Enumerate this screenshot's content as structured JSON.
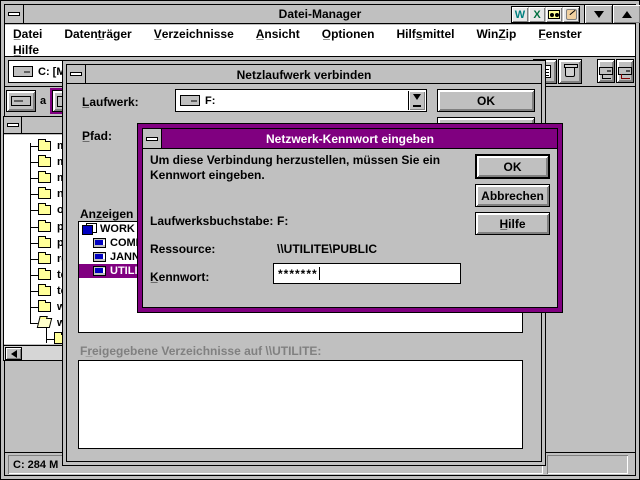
{
  "window": {
    "title": "Datei-Manager",
    "menu_row1": [
      "D̲atei",
      "Datent̲räger",
      "V̲erzeichnisse",
      "A̲nsicht",
      "O̲ptionen",
      "Hilfs̲mittel",
      "WinZ̲ip",
      "F̲enster"
    ],
    "menu_row2": [
      "H̲ilfe"
    ],
    "quick_icons": {
      "word": "W",
      "excel": "X"
    }
  },
  "filemanager": {
    "drive_combo_value": "C: [M",
    "drivebar_letter": "a",
    "tree_items": [
      "mirc",
      "msi",
      "mso",
      "net",
      "ope",
      "pma",
      "psp",
      "rea",
      "tera",
      "tota",
      "wel",
      "win",
      ""
    ],
    "status_left": "C: 284 M",
    "status_right": ""
  },
  "connect_dialog": {
    "title": "Netzlaufwerk verbinden",
    "drive_label": "L̲aufwerk:",
    "drive_value": "F:",
    "path_label": "P̲fad:",
    "ok_label": "OK",
    "browse_label": "Anz̲eigen",
    "computers": [
      {
        "name": "WORK",
        "type": "workgroup",
        "selected": false
      },
      {
        "name": "COMP",
        "type": "computer",
        "selected": false
      },
      {
        "name": "JANN",
        "type": "computer",
        "selected": false
      },
      {
        "name": "UTILI",
        "type": "computer",
        "selected": true
      }
    ],
    "shared_label": "Fr̲eigegebene Verzeichnisse auf \\\\UTILITE:"
  },
  "password_dialog": {
    "title": "Netzwerk-Kennwort eingeben",
    "message_line1": "Um diese Verbindung herzustellen, müssen Sie ein",
    "message_line2": "Kennwort eingeben.",
    "drive_letter_label": "Laufwerksbuchstabe:",
    "drive_letter_value": "F:",
    "resource_label": "Ressource:",
    "resource_value": "\\\\UTILITE\\PUBLIC",
    "password_label": "K̲ennwort:",
    "password_value": "*******",
    "ok_label": "OK",
    "cancel_label": "Abbrechen",
    "help_label": "H̲ilfe"
  },
  "colors": {
    "accent": "#800080",
    "chrome": "#c0c0c0",
    "disabled_text": "#808080"
  }
}
